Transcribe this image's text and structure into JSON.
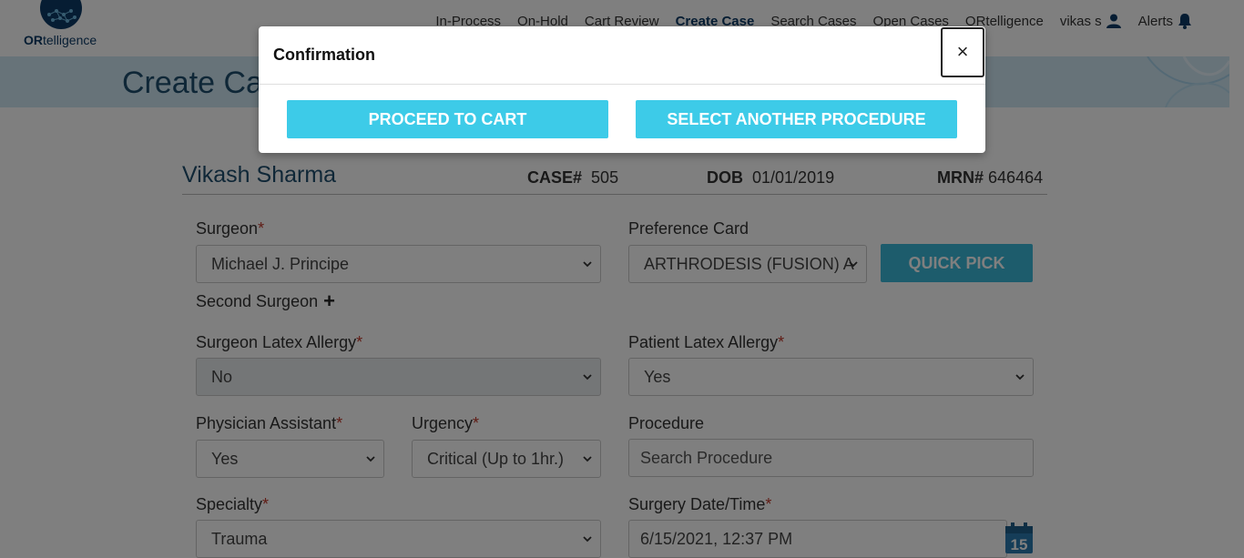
{
  "brand": {
    "logo_prefix": "OR",
    "logo_suffix": "telligence"
  },
  "nav": {
    "items": [
      "In-Process",
      "On-Hold",
      "Cart Review",
      "Create Case",
      "Search Cases",
      "Open Cases",
      "ORtelligence"
    ],
    "active": "Create Case",
    "user": "vikas s",
    "alerts": "Alerts"
  },
  "page": {
    "title": "Create Case"
  },
  "patient": {
    "name": "Vikash Sharma",
    "case_label": "CASE#",
    "case_value": "505",
    "dob_label": "DOB",
    "dob_value": "01/01/2019",
    "mrn_label": "MRN#",
    "mrn_value": "646464"
  },
  "form": {
    "surgeon_label": "Surgeon",
    "surgeon_value": "Michael J. Principe",
    "pref_card_label": "Preference Card",
    "pref_card_value": "ARTHRODESIS (FUSION) A",
    "quick_pick": "QUICK PICK",
    "second_surgeon": "Second Surgeon",
    "surgeon_latex_label": "Surgeon Latex Allergy",
    "surgeon_latex_value": "No",
    "patient_latex_label": "Patient Latex Allergy",
    "patient_latex_value": "Yes",
    "pa_label": "Physician Assistant",
    "pa_value": "Yes",
    "urgency_label": "Urgency",
    "urgency_value": "Critical (Up to 1hr.)",
    "procedure_label": "Procedure",
    "procedure_placeholder": "Search Procedure",
    "specialty_label": "Specialty",
    "specialty_value": "Trauma",
    "surgery_dt_label": "Surgery Date/Time",
    "surgery_dt_value": "6/15/2021, 12:37 PM",
    "calendar_day": "15",
    "required_mark": "*"
  },
  "modal": {
    "title": "Confirmation",
    "close": "×",
    "proceed": "PROCEED TO CART",
    "select_another": "SELECT ANOTHER PROCEDURE"
  },
  "colors": {
    "primary": "#3dcbe8",
    "brand_dark": "#0d3b66",
    "banner": "#cfe7f3",
    "required": "#c0392b"
  }
}
